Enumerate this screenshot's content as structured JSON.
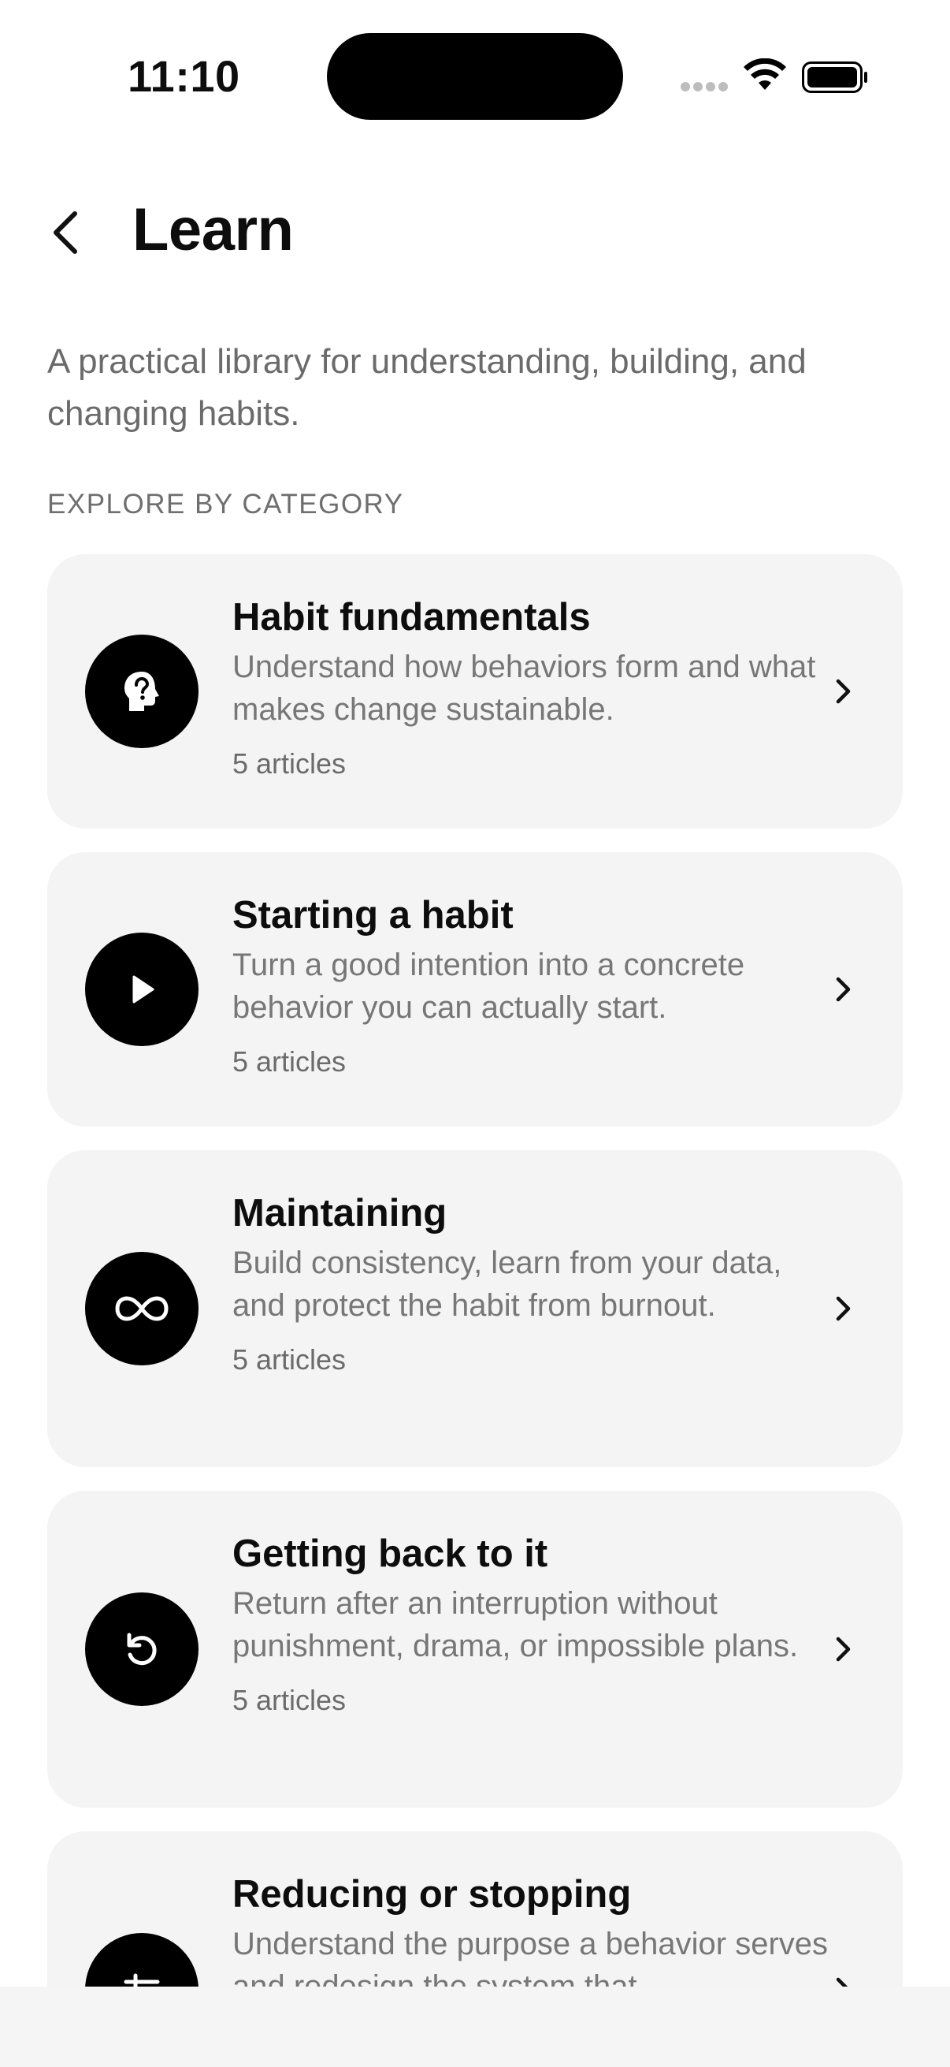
{
  "status_bar": {
    "time": "11:10",
    "icons": [
      "cellular-signal-icon",
      "wifi-icon",
      "battery-icon"
    ]
  },
  "header": {
    "back_icon": "chevron-left-icon",
    "title": "Learn"
  },
  "intro": "A practical library for understanding, building, and changing habits.",
  "section_label": "EXPLORE BY CATEGORY",
  "categories": [
    {
      "icon": "head-question-icon",
      "title": "Habit fundamentals",
      "description": "Understand how behaviors form and what makes change sustainable.",
      "count": "5 articles"
    },
    {
      "icon": "play-icon",
      "title": "Starting a habit",
      "description": "Turn a good intention into a concrete behavior you can actually start.",
      "count": "5 articles"
    },
    {
      "icon": "infinity-icon",
      "title": "Maintaining",
      "description": "Build consistency, learn from your data, and protect the habit from burnout.",
      "count": "5 articles"
    },
    {
      "icon": "rotate-ccw-icon",
      "title": "Getting back to it",
      "description": "Return after an interruption without punishment, drama, or impossible plans.",
      "count": "5 articles"
    },
    {
      "icon": "sliders-icon",
      "title": "Reducing or stopping",
      "description": "Understand the purpose a behavior serves and redesign the system that",
      "count": ""
    }
  ],
  "colors": {
    "card_background": "#f4f4f4",
    "icon_circle": "#000000",
    "text_primary": "#0d0d0d",
    "text_secondary": "#777777"
  }
}
